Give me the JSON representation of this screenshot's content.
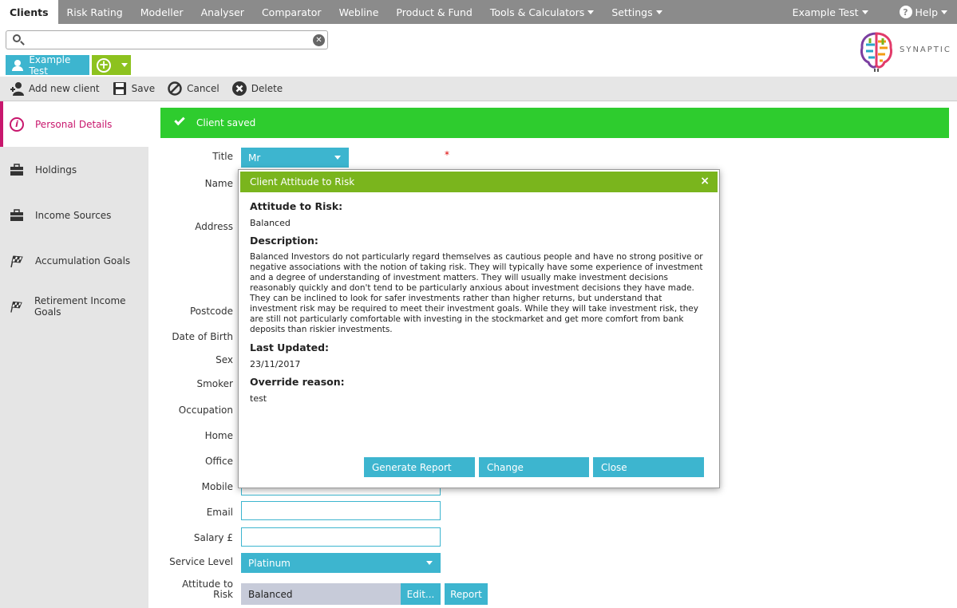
{
  "nav": {
    "items": [
      "Clients",
      "Risk Rating",
      "Modeller",
      "Analyser",
      "Comparator",
      "Webline",
      "Product & Fund",
      "Tools & Calculators",
      "Settings"
    ],
    "user": "Example Test",
    "help": "Help"
  },
  "search": {
    "value": "",
    "placeholder": ""
  },
  "client": {
    "name": "Example Test"
  },
  "logo": {
    "text": "SYNAPTIC"
  },
  "toolbar": {
    "add_new": "Add new client",
    "save": "Save",
    "cancel": "Cancel",
    "delete": "Delete"
  },
  "sidebar": {
    "items": [
      {
        "label": "Personal Details",
        "icon": "info-icon"
      },
      {
        "label": "Holdings",
        "icon": "briefcase-icon"
      },
      {
        "label": "Income Sources",
        "icon": "briefcase-icon"
      },
      {
        "label": "Accumulation Goals",
        "icon": "checkered-flag-icon"
      },
      {
        "label": "Retirement Income Goals",
        "icon": "checkered-flag-icon"
      }
    ]
  },
  "banner": {
    "message": "Client saved"
  },
  "form": {
    "title_label": "Title",
    "title_value": "Mr",
    "name_label": "Name",
    "address_label": "Address",
    "postcode_label": "Postcode",
    "dob_label": "Date of Birth",
    "sex_label": "Sex",
    "smoker_label": "Smoker",
    "occupation_label": "Occupation",
    "home_label": "Home",
    "office_label": "Office",
    "mobile_label": "Mobile",
    "email_label": "Email",
    "salary_label": "Salary £",
    "service_label": "Service Level",
    "service_value": "Platinum",
    "atr_label_1": "Attitude to",
    "atr_label_2": "Risk",
    "atr_value": "Balanced",
    "edit_label": "Edit...",
    "report_label": "Report",
    "required_mark": "*"
  },
  "modal": {
    "title": "Client Attitude to Risk",
    "close_icon": "×",
    "atr_heading": "Attitude to Risk:",
    "atr_value": "Balanced",
    "desc_heading": "Description:",
    "desc_text": "Balanced Investors do not particularly regard themselves as cautious people and have no strong positive or negative associations with the notion of taking risk. They will typically have some experience of investment and a degree of understanding of investment matters. They will usually make investment decisions reasonably quickly and don't tend to be particularly anxious about investment decisions they have made. They can be inclined to look for safer investments rather than higher returns, but understand that investment risk may be required to meet their investment goals. While they will take investment risk, they are still not particularly comfortable with investing in the stockmarket and get more comfort from bank deposits than riskier investments.",
    "updated_heading": "Last Updated:",
    "updated_value": "23/11/2017",
    "override_heading": "Override reason:",
    "override_value": "test",
    "btn_generate": "Generate Report",
    "btn_change": "Change",
    "btn_close": "Close"
  },
  "colors": {
    "nav_bg": "#8b8b8b",
    "teal": "#3db5cf",
    "green": "#8dc21f",
    "banner": "#2ecc2e",
    "modal_head": "#7ab51d",
    "accent": "#c8176d"
  }
}
